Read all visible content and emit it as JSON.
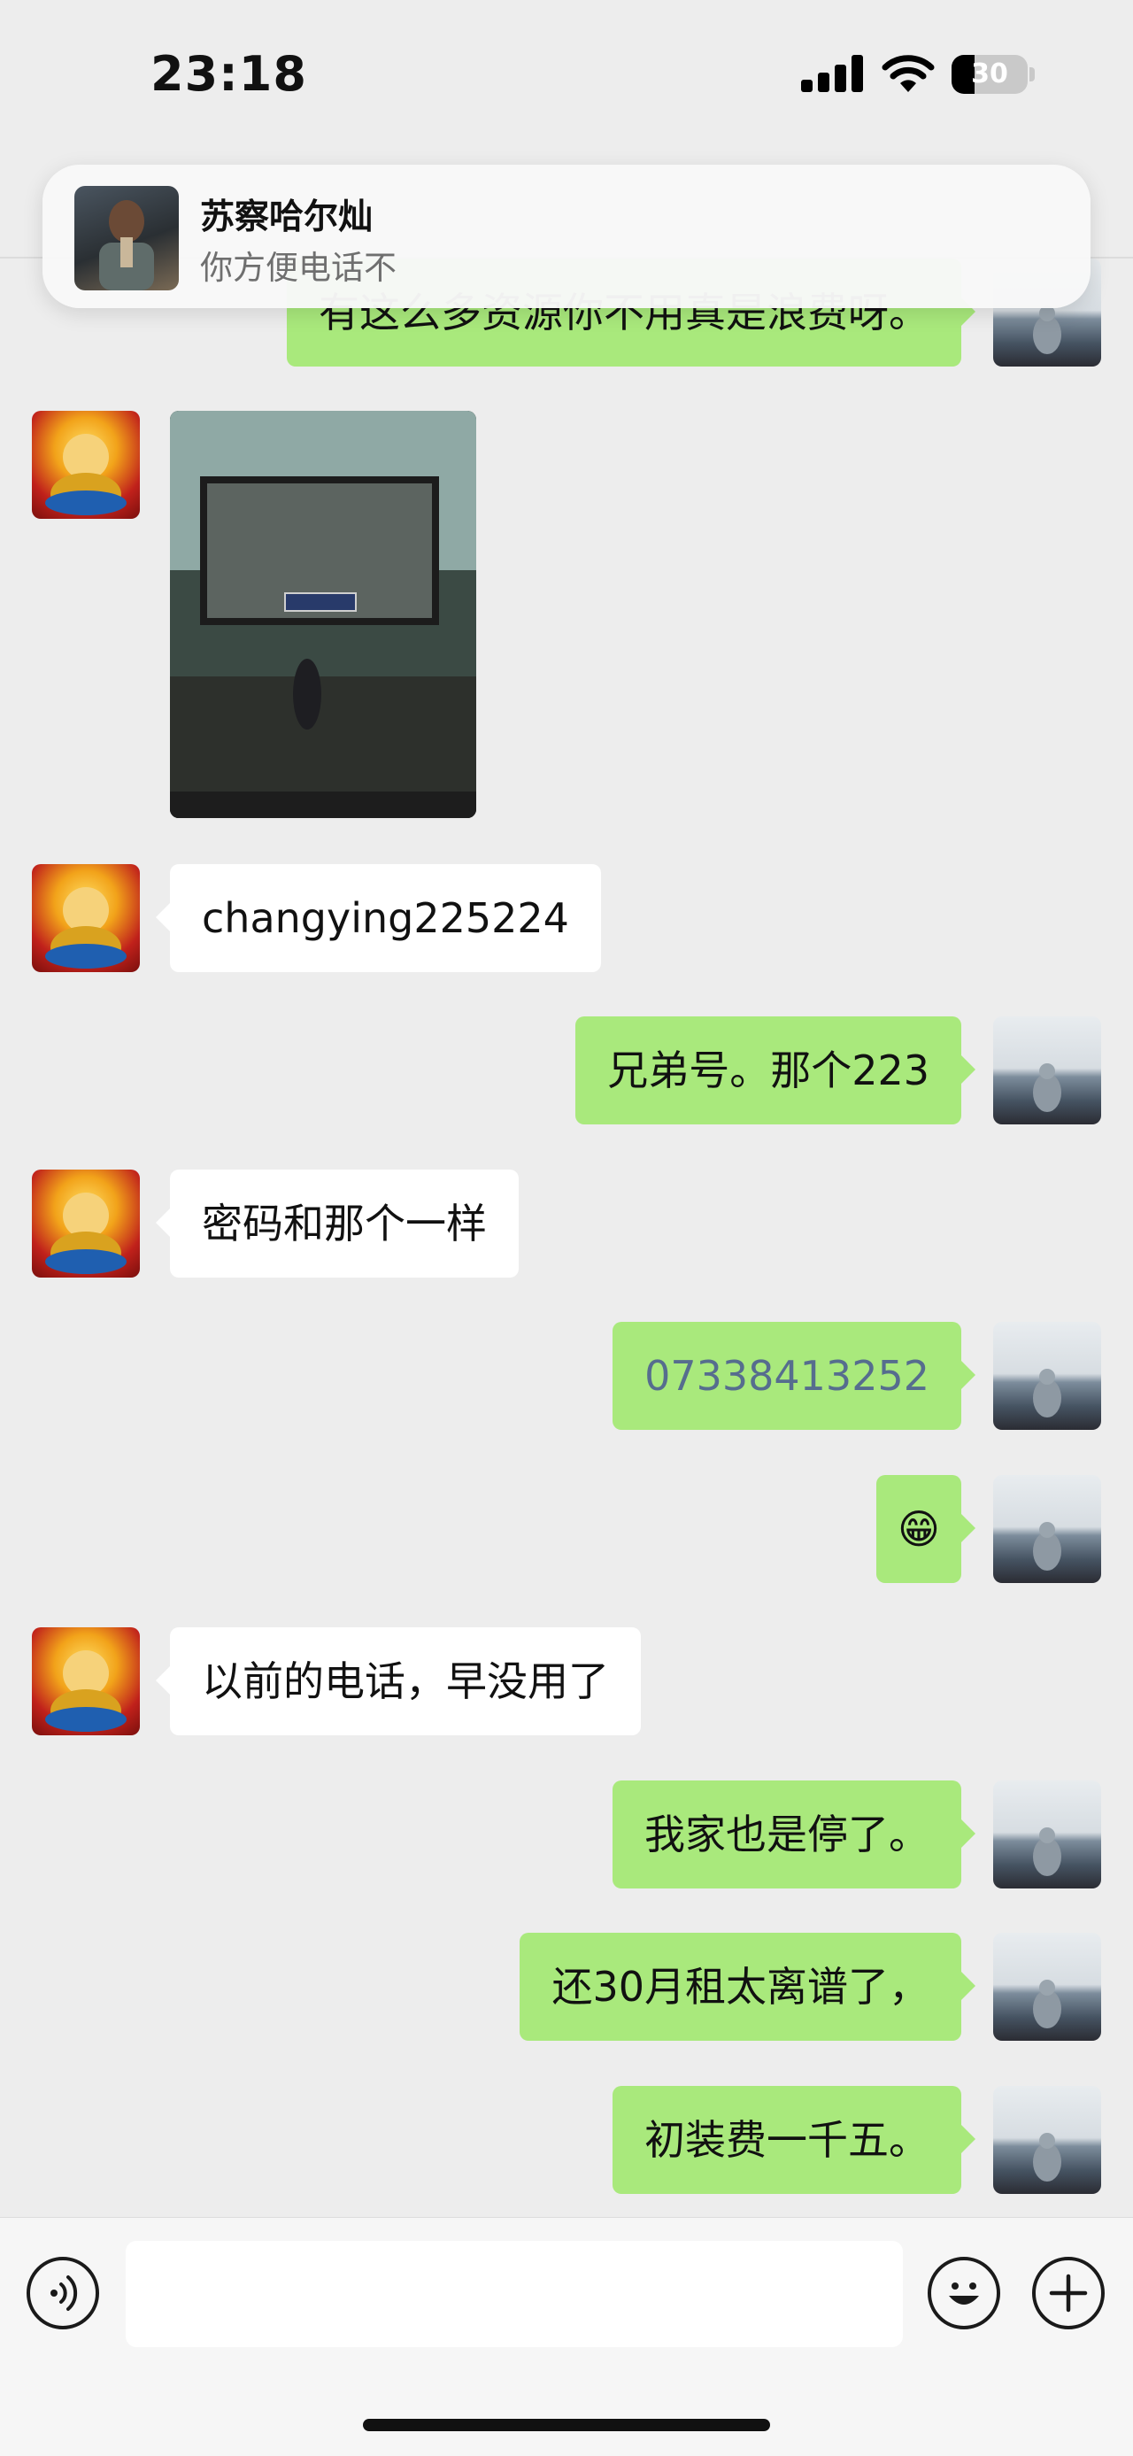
{
  "status_bar": {
    "time": "23:18",
    "battery_level": "30",
    "battery_fraction": 0.3,
    "signal_icon": "cellular-signal-icon",
    "wifi_icon": "wifi-icon",
    "battery_icon": "battery-icon"
  },
  "notification": {
    "sender": "苏察哈尔灿",
    "message": "你方便电话不"
  },
  "messages": [
    {
      "side": "right",
      "type": "text",
      "text": "有这么多资源你不用真是浪费呀。"
    },
    {
      "side": "left",
      "type": "image",
      "text": ""
    },
    {
      "side": "left",
      "type": "text",
      "text": "changying225224"
    },
    {
      "side": "right",
      "type": "text",
      "text": "兄弟号。那个223"
    },
    {
      "side": "left",
      "type": "text",
      "text": "密码和那个一样"
    },
    {
      "side": "right",
      "type": "link",
      "text": "07338413252"
    },
    {
      "side": "right",
      "type": "emoji",
      "text": "😁"
    },
    {
      "side": "left",
      "type": "text",
      "text": "以前的电话，早没用了"
    },
    {
      "side": "right",
      "type": "text",
      "text": "我家也是停了。"
    },
    {
      "side": "right",
      "type": "text",
      "text": "还30月租太离谱了，"
    },
    {
      "side": "right",
      "type": "text",
      "text": "初装费一千五。"
    }
  ],
  "input_bar": {
    "voice_icon": "voice-icon",
    "emoji_icon": "emoji-icon",
    "add_icon": "plus-icon",
    "input_value": ""
  },
  "colors": {
    "background": "#ededed",
    "sent_bubble": "#a9e97c",
    "received_bubble": "#ffffff",
    "link": "#566d8e"
  }
}
